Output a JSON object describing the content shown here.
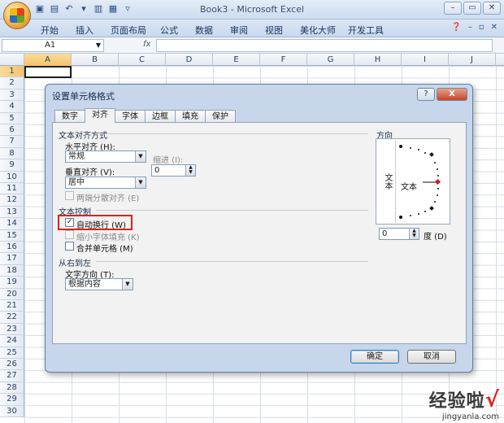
{
  "window": {
    "title": "Book3 - Microsoft Excel"
  },
  "ribbon": {
    "tabs": [
      "开始",
      "插入",
      "页面布局",
      "公式",
      "数据",
      "审阅",
      "视图",
      "美化大师",
      "开发工具"
    ]
  },
  "formula_bar": {
    "name_box": "A1",
    "fx": "fx",
    "value": ""
  },
  "grid": {
    "columns": [
      "A",
      "B",
      "C",
      "D",
      "E",
      "F",
      "G",
      "H",
      "I",
      "J"
    ],
    "rows": [
      "1",
      "2",
      "3",
      "4",
      "5",
      "6",
      "7",
      "8",
      "9",
      "10",
      "11",
      "12",
      "13",
      "14",
      "15",
      "16",
      "17",
      "18",
      "19",
      "20",
      "21",
      "22",
      "23",
      "24",
      "25",
      "26",
      "27",
      "28",
      "29",
      "30"
    ]
  },
  "dialog": {
    "title": "设置单元格格式",
    "tabs": [
      "数字",
      "对齐",
      "字体",
      "边框",
      "填充",
      "保护"
    ],
    "active_tab": "对齐",
    "text_alignment": {
      "section": "文本对齐方式",
      "horizontal_label": "水平对齐 (H):",
      "horizontal_value": "常规",
      "indent_label": "缩进 (I):",
      "indent_value": "0",
      "vertical_label": "垂直对齐 (V):",
      "vertical_value": "居中",
      "distributed_label": "两端分散对齐 (E)"
    },
    "text_control": {
      "section": "文本控制",
      "wrap_label": "自动换行 (W)",
      "wrap_checked": true,
      "shrink_label": "缩小字体填充 (K)",
      "merge_label": "合并单元格 (M)"
    },
    "rtl": {
      "section": "从右到左",
      "direction_label": "文字方向 (T):",
      "direction_value": "根据内容"
    },
    "orientation": {
      "section": "方向",
      "vertical_text": "文本",
      "text_label": "文本",
      "degrees_value": "0",
      "degrees_label": "度 (D)"
    },
    "ok_label": "确定",
    "cancel_label": "取消",
    "help_label": "?",
    "close_label": "X"
  },
  "watermark": {
    "main": "经验啦",
    "check": "√",
    "url": "jingyanla.com"
  }
}
